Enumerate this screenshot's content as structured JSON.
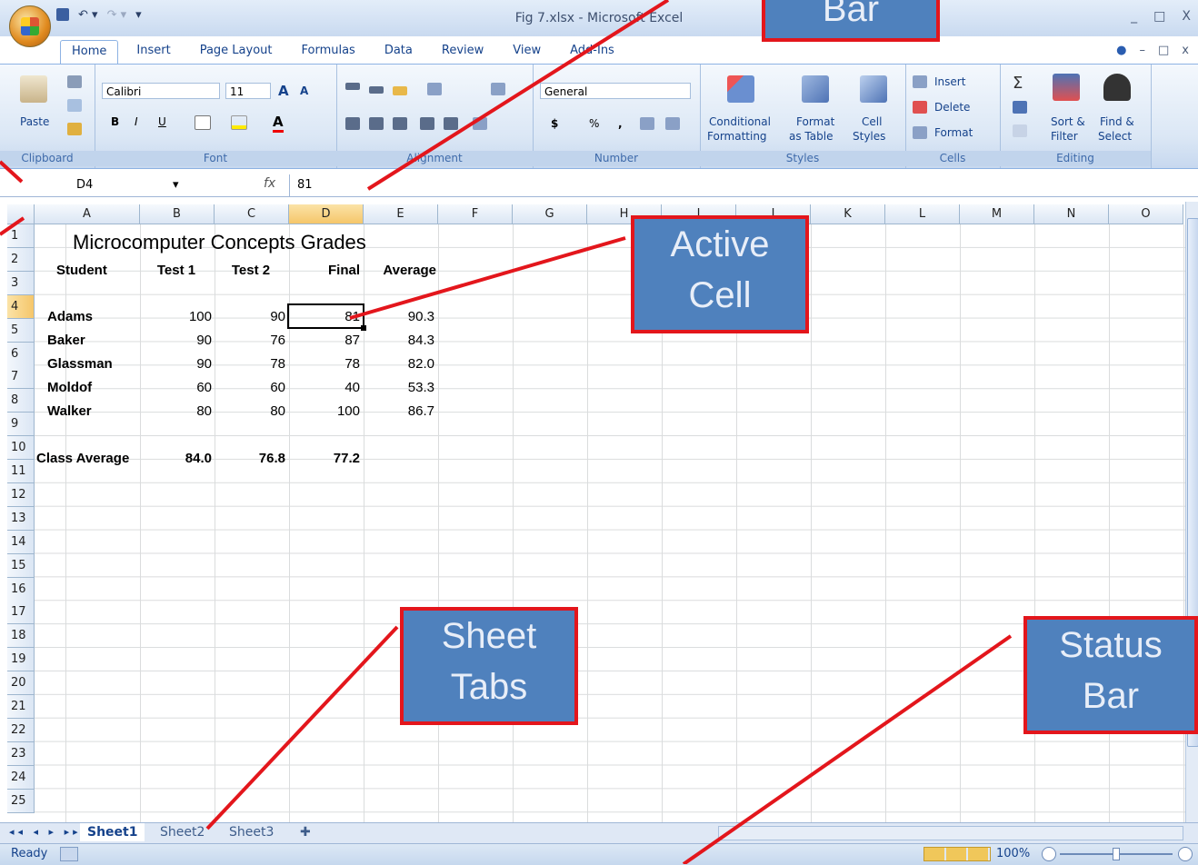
{
  "window": {
    "title": "Fig 7.xlsx - Microsoft Excel",
    "controls": [
      "_",
      "□",
      "X"
    ]
  },
  "quick_access": {
    "items": [
      "save-icon",
      "undo-icon",
      "redo-icon",
      "customize-icon"
    ]
  },
  "ribbon_tabs": [
    "Home",
    "Insert",
    "Page Layout",
    "Formulas",
    "Data",
    "Review",
    "View",
    "Add-Ins"
  ],
  "ribbon": {
    "clipboard": {
      "label": "Clipboard",
      "paste": "Paste"
    },
    "font": {
      "label": "Font",
      "name": "Calibri",
      "size": "11",
      "bold": "B",
      "italic": "I",
      "underline": "U",
      "grow": "A",
      "shrink": "A",
      "color": "A"
    },
    "alignment": {
      "label": "Alignment"
    },
    "number": {
      "label": "Number",
      "format": "General",
      "currency": "$",
      "percent": "%",
      "comma": ","
    },
    "styles": {
      "label": "Styles",
      "conditional": "Conditional",
      "conditional2": "Formatting",
      "format_table": "Format",
      "format_table2": "as Table",
      "cell_styles": "Cell",
      "cell_styles2": "Styles"
    },
    "cells": {
      "label": "Cells",
      "insert": "Insert",
      "delete": "Delete",
      "format": "Format"
    },
    "editing": {
      "label": "Editing",
      "sort": "Sort &",
      "sort2": "Filter",
      "find": "Find &",
      "find2": "Select"
    }
  },
  "formula_bar": {
    "name_box": "D4",
    "fx": "fx",
    "value": "81"
  },
  "columns": [
    "A",
    "B",
    "C",
    "D",
    "E",
    "F",
    "G",
    "H",
    "I",
    "J",
    "K",
    "L",
    "M",
    "N",
    "O"
  ],
  "rows": [
    "1",
    "2",
    "3",
    "4",
    "5",
    "6",
    "7",
    "8",
    "9",
    "10",
    "11",
    "12",
    "13",
    "14",
    "15",
    "16",
    "17",
    "18",
    "19",
    "20",
    "21",
    "22",
    "23",
    "24",
    "25"
  ],
  "sheet": {
    "title": "Microcomputer Concepts Grades",
    "headers": [
      "Student",
      "Test 1",
      "Test 2",
      "Final",
      "Average"
    ],
    "students": [
      {
        "name": "Adams",
        "test1": "100",
        "test2": "90",
        "final": "81",
        "average": "90.3"
      },
      {
        "name": "Baker",
        "test1": "90",
        "test2": "76",
        "final": "87",
        "average": "84.3"
      },
      {
        "name": "Glassman",
        "test1": "90",
        "test2": "78",
        "final": "78",
        "average": "82.0"
      },
      {
        "name": "Moldof",
        "test1": "60",
        "test2": "60",
        "final": "40",
        "average": "53.3"
      },
      {
        "name": "Walker",
        "test1": "80",
        "test2": "80",
        "final": "100",
        "average": "86.7"
      }
    ],
    "class_average": {
      "label": "Class Average",
      "test1": "84.0",
      "test2": "76.8",
      "final": "77.2"
    }
  },
  "sheet_tabs": [
    "Sheet1",
    "Sheet2",
    "Sheet3"
  ],
  "status": {
    "text": "Ready",
    "zoom": "100%"
  },
  "callouts": {
    "formula_bar": "Bar",
    "active_cell": [
      "Active",
      "Cell"
    ],
    "sheet_tabs": [
      "Sheet",
      "Tabs"
    ],
    "status_bar": [
      "Status",
      "Bar"
    ]
  },
  "colors": {
    "callout_fill": "#4f81bd",
    "callout_border": "#e3161c",
    "ribbon": "#dbe7f5",
    "selected_header": "#f5c66a"
  }
}
